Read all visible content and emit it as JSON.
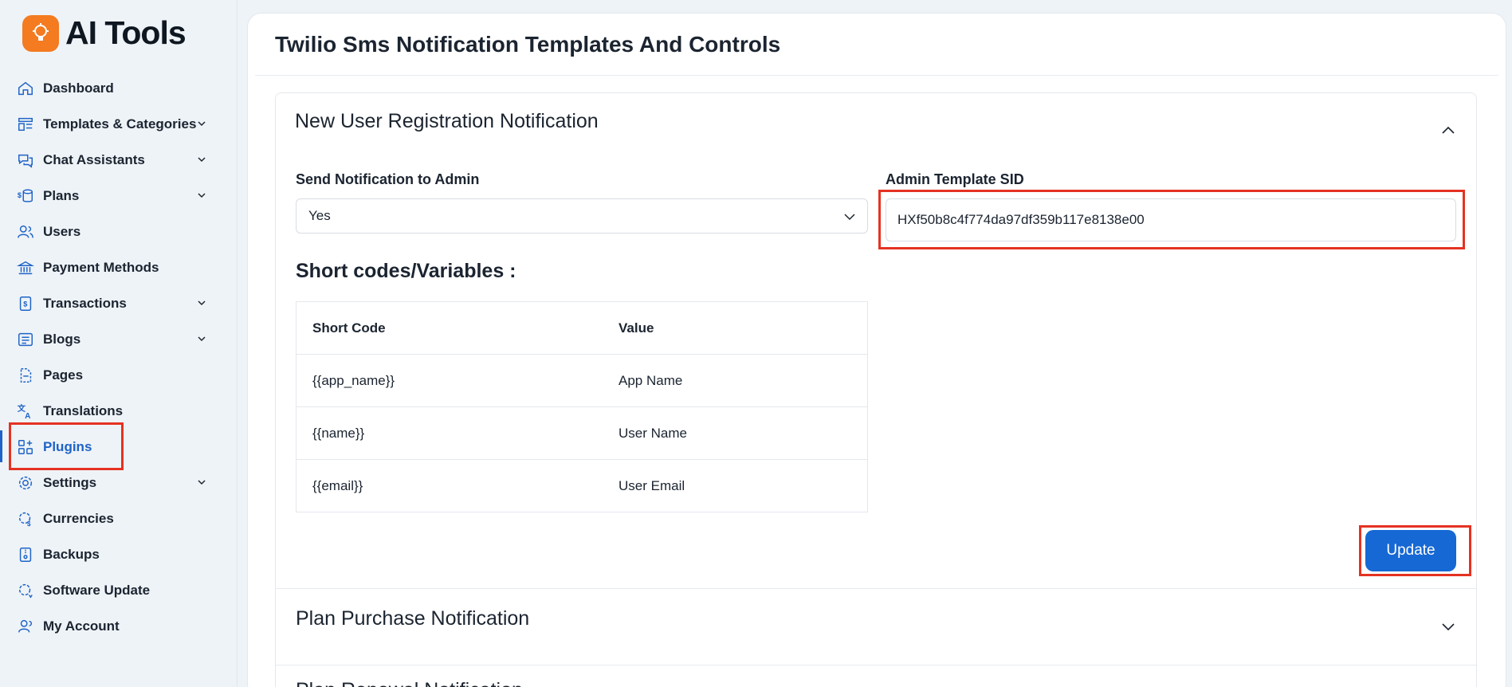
{
  "brand": {
    "name": "AI Tools",
    "color": "#f47b20"
  },
  "sidebar": {
    "items": [
      {
        "label": "Dashboard",
        "icon": "home-icon",
        "has_chevron": false
      },
      {
        "label": "Templates & Categories",
        "icon": "templates-icon",
        "has_chevron": true
      },
      {
        "label": "Chat Assistants",
        "icon": "chat-icon",
        "has_chevron": true
      },
      {
        "label": "Plans",
        "icon": "plans-coins-icon",
        "has_chevron": true
      },
      {
        "label": "Users",
        "icon": "users-icon",
        "has_chevron": false
      },
      {
        "label": "Payment Methods",
        "icon": "bank-icon",
        "has_chevron": false
      },
      {
        "label": "Transactions",
        "icon": "receipt-icon",
        "has_chevron": true
      },
      {
        "label": "Blogs",
        "icon": "blog-icon",
        "has_chevron": true
      },
      {
        "label": "Pages",
        "icon": "page-icon",
        "has_chevron": false
      },
      {
        "label": "Translations",
        "icon": "translate-icon",
        "has_chevron": false
      },
      {
        "label": "Plugins",
        "icon": "plugins-icon",
        "has_chevron": false,
        "active": true
      },
      {
        "label": "Settings",
        "icon": "gear-icon",
        "has_chevron": true
      },
      {
        "label": "Currencies",
        "icon": "currency-gear-icon",
        "has_chevron": false
      },
      {
        "label": "Backups",
        "icon": "backup-icon",
        "has_chevron": false
      },
      {
        "label": "Software Update",
        "icon": "update-gear-icon",
        "has_chevron": false
      },
      {
        "label": "My Account",
        "icon": "account-icon",
        "has_chevron": false
      }
    ]
  },
  "page": {
    "title": "Twilio Sms Notification Templates And Controls"
  },
  "section1": {
    "title": "New User Registration Notification",
    "send_label": "Send Notification to Admin",
    "send_value": "Yes",
    "sid_label": "Admin Template SID",
    "sid_value": "HXf50b8c4f774da97df359b117e8138e00",
    "shortcodes_title": "Short codes/Variables :",
    "table": {
      "headers": [
        "Short Code",
        "Value"
      ],
      "rows": [
        [
          "{{app_name}}",
          "App Name"
        ],
        [
          "{{name}}",
          "User Name"
        ],
        [
          "{{email}}",
          "User Email"
        ]
      ]
    },
    "update_label": "Update"
  },
  "section2": {
    "title": "Plan Purchase Notification"
  },
  "section3": {
    "title": "Plan Renewal Notification"
  },
  "colors": {
    "accent": "#1668d4",
    "highlight": "#e53222"
  }
}
